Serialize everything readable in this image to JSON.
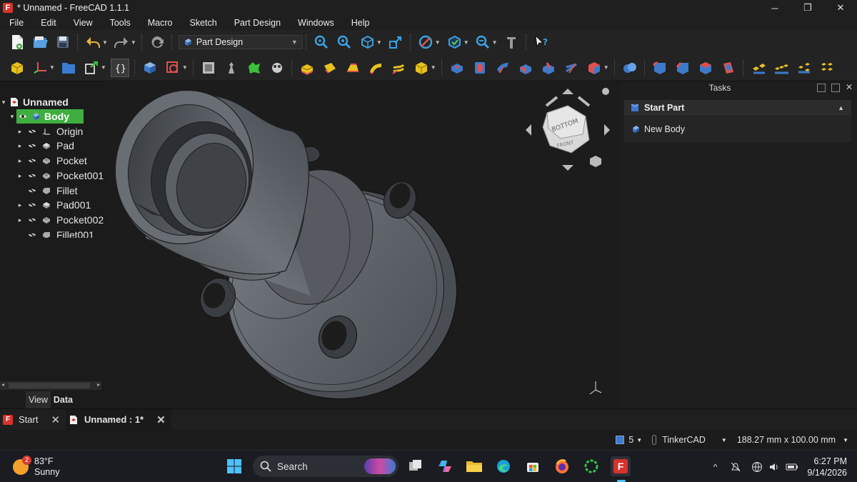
{
  "window": {
    "title": "* Unnamed - FreeCAD 1.1.1",
    "app_icon": "freecad-icon",
    "minimize": "─",
    "maximize": "❐",
    "close": "✕"
  },
  "menu": [
    "File",
    "Edit",
    "View",
    "Tools",
    "Macro",
    "Sketch",
    "Part Design",
    "Windows",
    "Help"
  ],
  "toolbar": {
    "workbench": "Part Design"
  },
  "tree": {
    "root": "Unnamed",
    "body": "Body",
    "items": [
      "Origin",
      "Pad",
      "Pocket",
      "Pocket001",
      "Fillet",
      "Pad001",
      "Pocket002",
      "Fillet001"
    ]
  },
  "panel_tabs": [
    "View",
    "Data"
  ],
  "tasks": {
    "title": "Tasks",
    "section": "Start Part",
    "action": "New Body"
  },
  "nav_cube": {
    "top_face": "BOTTOM",
    "front_face": "FRONT"
  },
  "doc_tabs": [
    {
      "label": "Start"
    },
    {
      "label": "Unnamed : 1*"
    }
  ],
  "status": {
    "count": "5",
    "nav_style": "TinkerCAD",
    "dimensions": "188.27 mm x 100.00 mm"
  },
  "taskbar": {
    "weather_temp": "83°F",
    "weather_desc": "Sunny",
    "weather_badge": "2",
    "search_label": "Search",
    "time": "6:27 PM",
    "date": "9/14/2026"
  },
  "colors": {
    "accent_green": "#3fae3f",
    "freecad_red": "#d8322c",
    "part_gray": "#5e6369"
  }
}
